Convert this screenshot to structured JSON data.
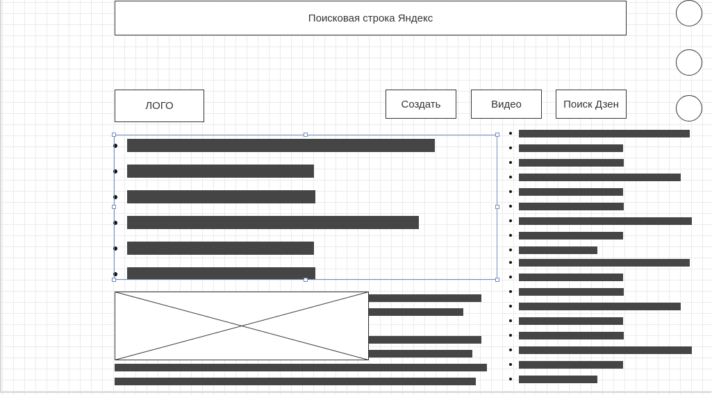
{
  "header": {
    "search_bar_label": "Поисковая строка Яндекс"
  },
  "nav": {
    "logo_label": "ЛОГО",
    "buttons": [
      "Создать",
      "Видео",
      "Поиск Дзен"
    ]
  },
  "icons": {
    "image_placeholder": "image-placeholder-icon",
    "side_circles": "circle-icon"
  },
  "colors": {
    "bar": "#454545",
    "selection": "#6c8ebf",
    "outline": "#333333"
  }
}
